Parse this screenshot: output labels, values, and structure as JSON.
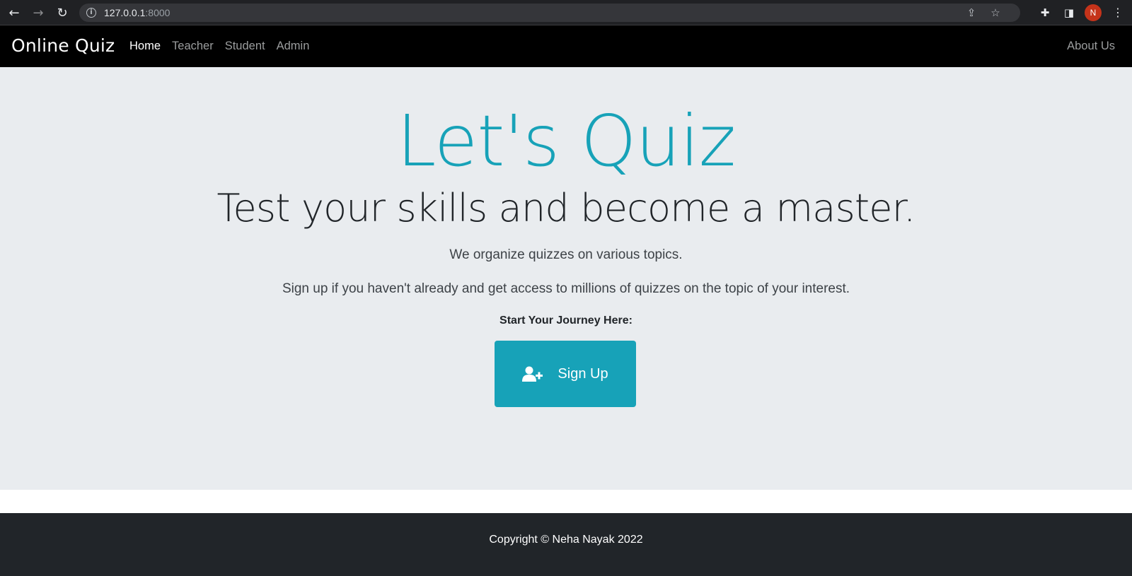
{
  "browser": {
    "url_host": "127.0.0.1",
    "url_port": ":8000",
    "profile_initial": "N"
  },
  "navbar": {
    "brand": "Online Quiz",
    "links": [
      {
        "label": "Home",
        "active": true
      },
      {
        "label": "Teacher",
        "active": false
      },
      {
        "label": "Student",
        "active": false
      },
      {
        "label": "Admin",
        "active": false
      }
    ],
    "right_link": "About Us"
  },
  "hero": {
    "title": "Let's Quiz",
    "lead": "Test your skills and become a master.",
    "paragraph1": "We organize quizzes on various topics.",
    "paragraph2": "Sign up if you haven't already and get access to millions of quizzes on the topic of your interest.",
    "start_label": "Start Your Journey Here:",
    "signup_button": {
      "label": "Sign Up",
      "icon": "user-plus-icon"
    }
  },
  "footer": {
    "copyright": "Copyright © Neha Nayak 2022"
  },
  "colors": {
    "accent": "#17a2b8",
    "navbar_bg": "#000000",
    "hero_bg": "#e9ecef",
    "footer_bg": "#212529",
    "profile_bg": "#c5331a"
  }
}
